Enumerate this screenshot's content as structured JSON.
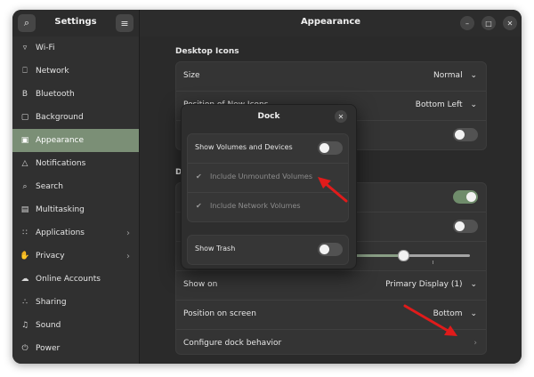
{
  "sidebar": {
    "title": "Settings",
    "search_icon": "search-icon",
    "menu_icon": "menu-icon",
    "items": [
      {
        "label": "Wi-Fi",
        "icon": "wifi-icon"
      },
      {
        "label": "Network",
        "icon": "network-icon"
      },
      {
        "label": "Bluetooth",
        "icon": "bluetooth-icon"
      },
      {
        "label": "Background",
        "icon": "background-icon"
      },
      {
        "label": "Appearance",
        "icon": "appearance-icon"
      },
      {
        "label": "Notifications",
        "icon": "bell-icon"
      },
      {
        "label": "Search",
        "icon": "search-icon"
      },
      {
        "label": "Multitasking",
        "icon": "multitasking-icon"
      },
      {
        "label": "Applications",
        "icon": "apps-grid-icon"
      },
      {
        "label": "Privacy",
        "icon": "hand-icon"
      },
      {
        "label": "Online Accounts",
        "icon": "cloud-icon"
      },
      {
        "label": "Sharing",
        "icon": "share-icon"
      },
      {
        "label": "Sound",
        "icon": "music-note-icon"
      },
      {
        "label": "Power",
        "icon": "power-icon"
      }
    ],
    "active": "Appearance"
  },
  "main": {
    "title": "Appearance",
    "desktop_icons": {
      "heading": "Desktop Icons",
      "size_label": "Size",
      "size_value": "Normal",
      "position_label": "Position of New Icons",
      "position_value": "Bottom Left",
      "show_personal_folder": false
    },
    "dock_heading_fragment": "D",
    "dock_rows": {
      "auto_hide": true,
      "panel_mode": false,
      "icon_size_level": 0.7,
      "show_on_label": "Show on",
      "show_on_value": "Primary Display (1)",
      "position_label": "Position on screen",
      "position_value": "Bottom",
      "configure_label": "Configure dock behavior"
    }
  },
  "dialog": {
    "title": "Dock",
    "show_volumes_label": "Show Volumes and Devices",
    "show_volumes_on": false,
    "include_unmounted_label": "Include Unmounted Volumes",
    "include_network_label": "Include Network Volumes",
    "show_trash_label": "Show Trash",
    "show_trash_on": false
  },
  "colors": {
    "accent": "#7b8f76",
    "annotation_arrow": "#e01b1b"
  }
}
